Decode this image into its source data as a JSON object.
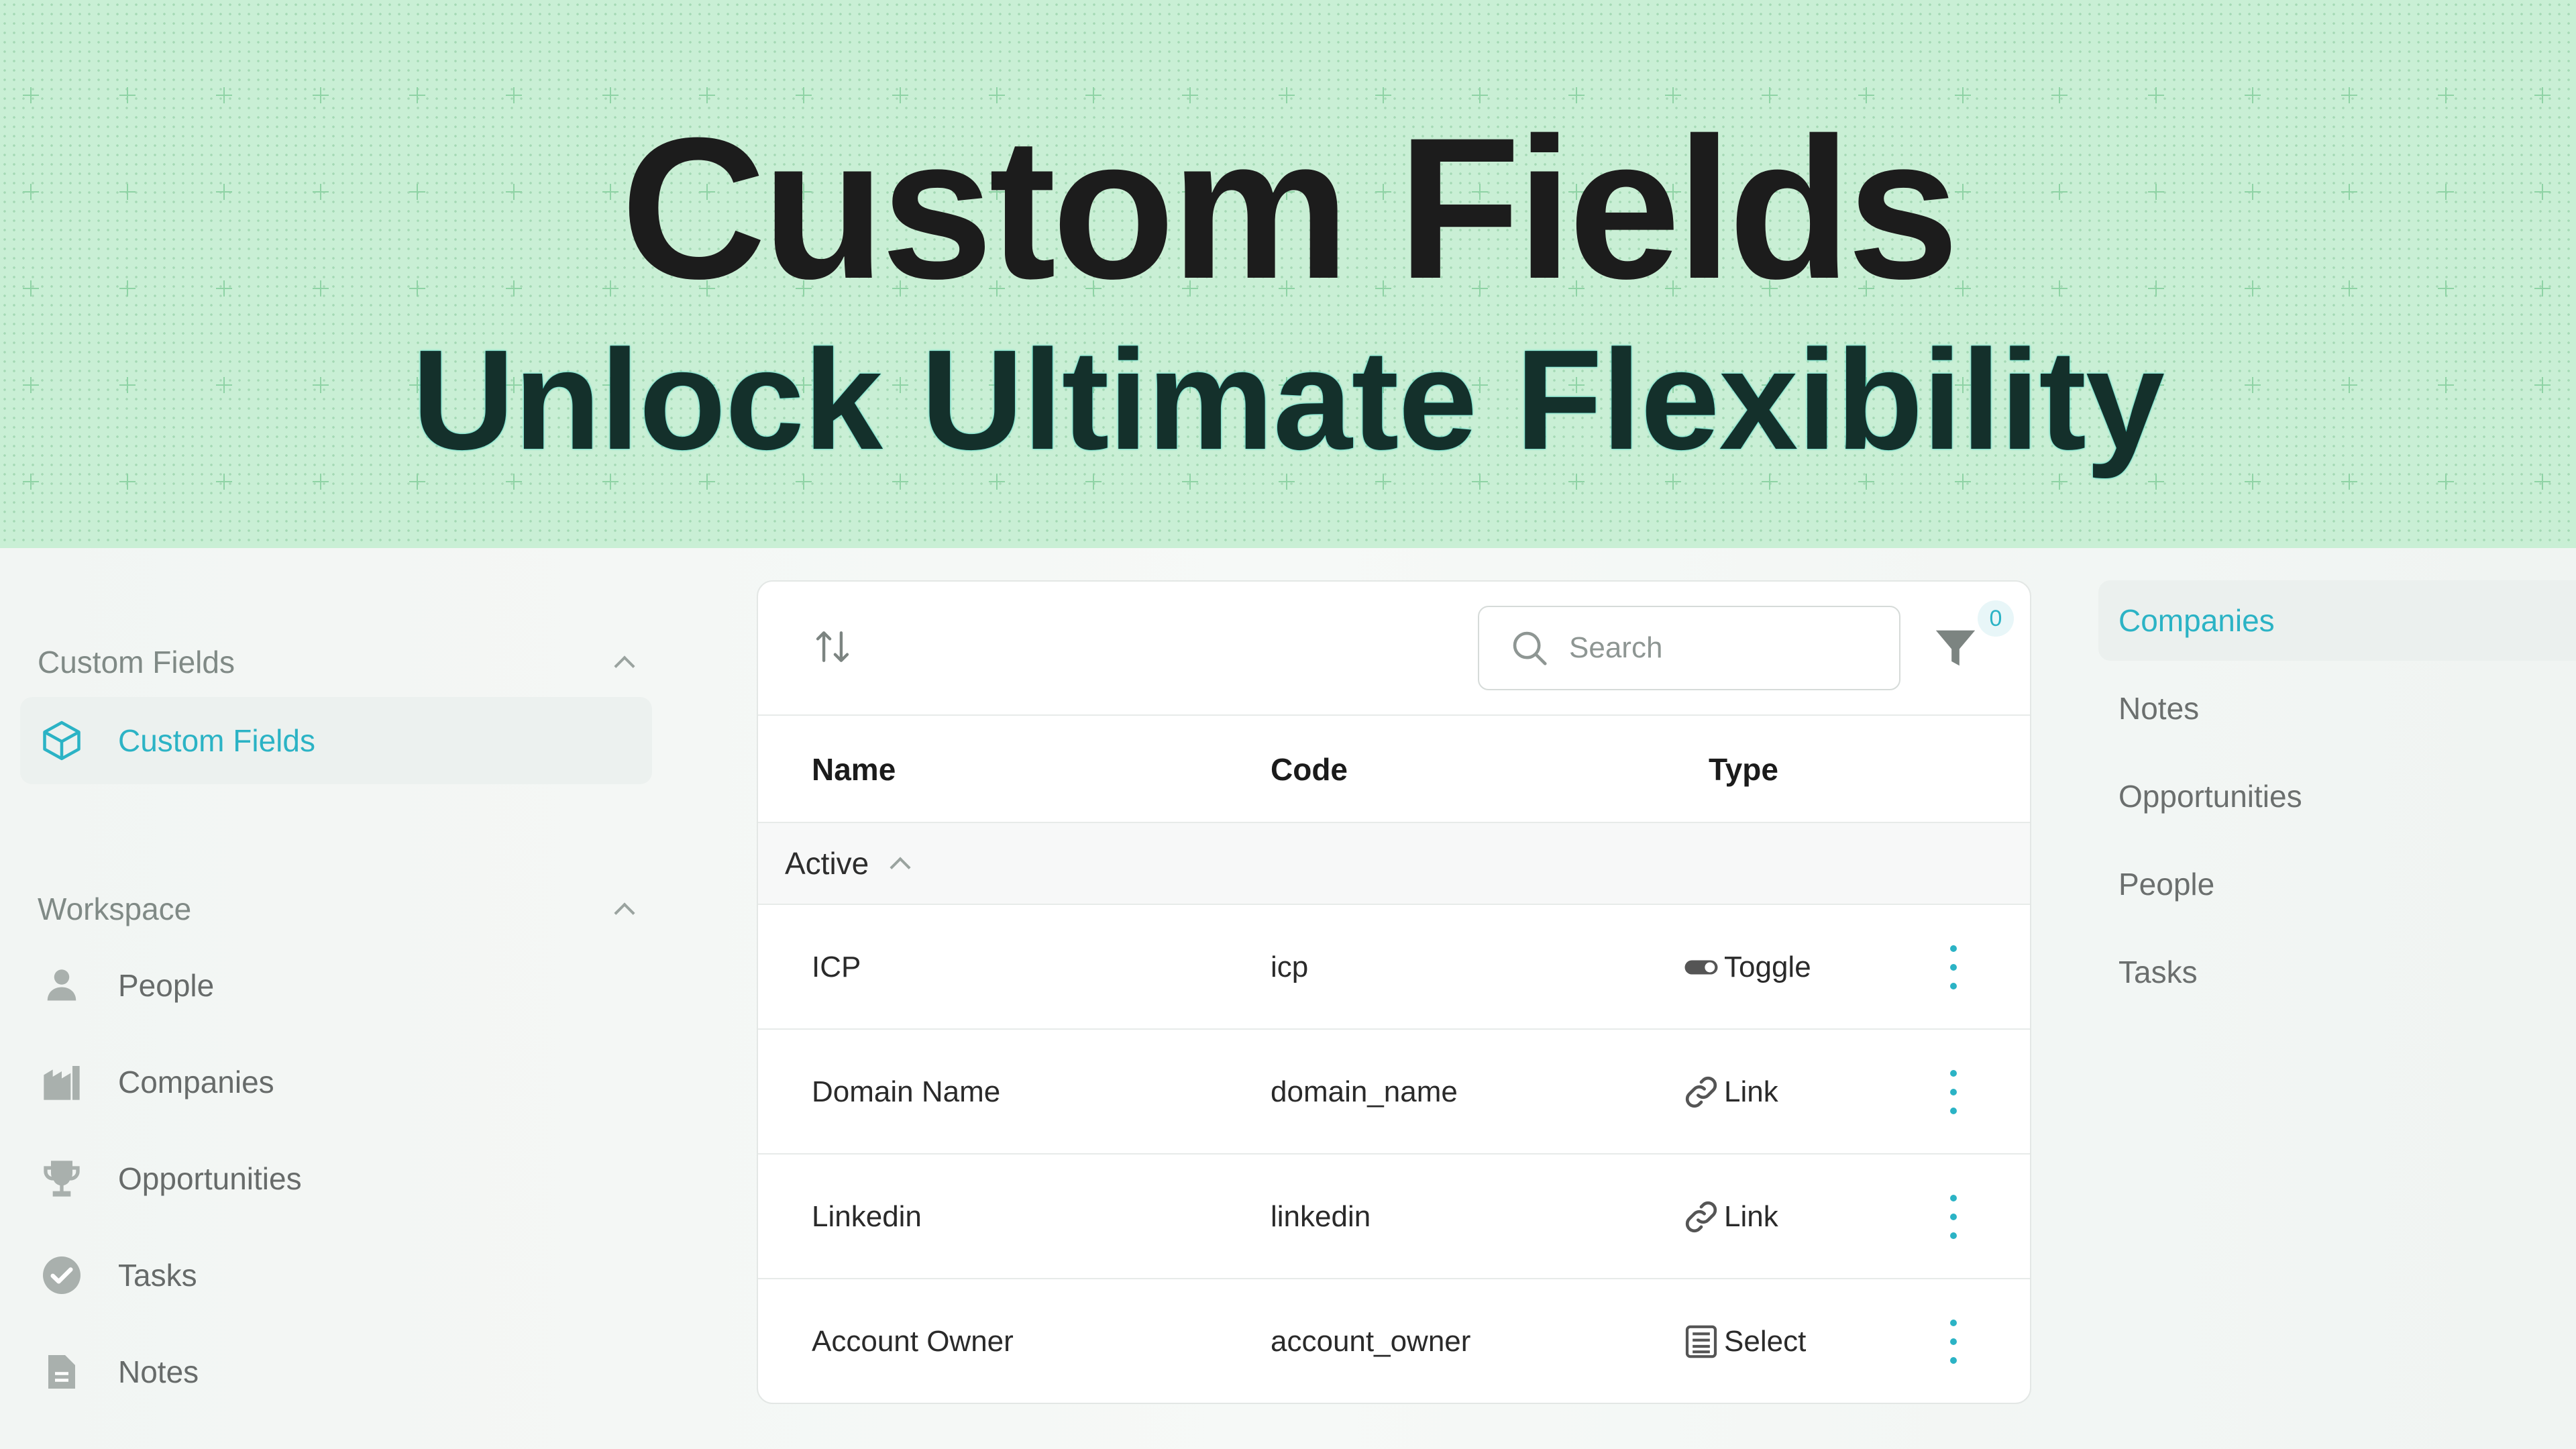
{
  "hero": {
    "title": "Custom Fields",
    "subtitle": "Unlock Ultimate Flexibility"
  },
  "sidebar": {
    "section_custom_fields": "Custom Fields",
    "custom_fields_item": "Custom Fields",
    "section_workspace": "Workspace",
    "workspace_items": [
      {
        "label": "People",
        "icon": "person-icon"
      },
      {
        "label": "Companies",
        "icon": "building-icon"
      },
      {
        "label": "Opportunities",
        "icon": "trophy-icon"
      },
      {
        "label": "Tasks",
        "icon": "check-circle-icon"
      },
      {
        "label": "Notes",
        "icon": "document-icon"
      }
    ]
  },
  "table": {
    "search_placeholder": "Search",
    "filter_count": "0",
    "columns": [
      "Name",
      "Code",
      "Type"
    ],
    "group_label": "Active",
    "rows": [
      {
        "name": "ICP",
        "code": "icp",
        "type": "Toggle",
        "type_icon": "toggle-icon"
      },
      {
        "name": "Domain Name",
        "code": "domain_name",
        "type": "Link",
        "type_icon": "link-icon"
      },
      {
        "name": "Linkedin",
        "code": "linkedin",
        "type": "Link",
        "type_icon": "link-icon"
      },
      {
        "name": "Account Owner",
        "code": "account_owner",
        "type": "Select",
        "type_icon": "select-icon"
      }
    ]
  },
  "right_nav": {
    "items": [
      "Companies",
      "Notes",
      "Opportunities",
      "People",
      "Tasks"
    ],
    "active": "Companies"
  },
  "colors": {
    "accent": "#2bb3c5",
    "hero_bg": "#c9efd5",
    "subtitle_glow": "#3ad1c3"
  }
}
